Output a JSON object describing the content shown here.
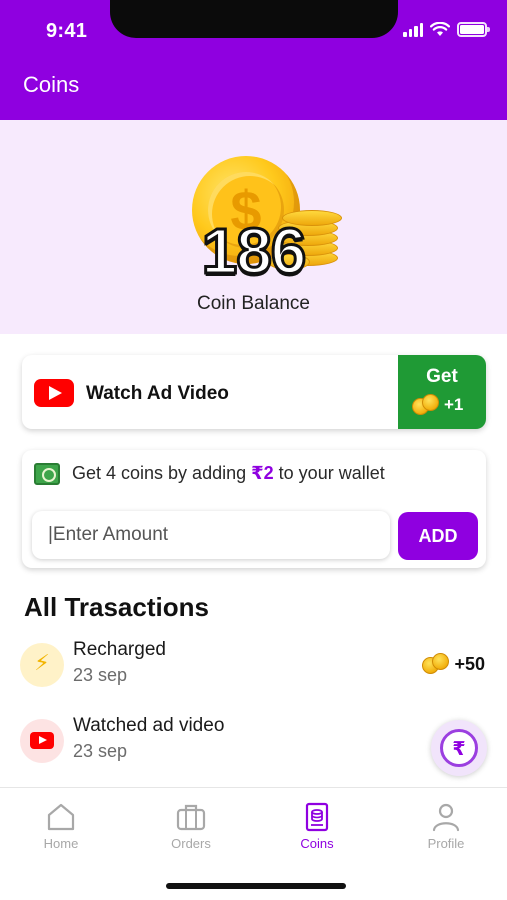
{
  "status_bar": {
    "time": "9:41"
  },
  "header": {
    "title": "Coins"
  },
  "balance": {
    "value": "186",
    "label": "Coin Balance"
  },
  "ad_card": {
    "label": "Watch Ad Video",
    "get_label": "Get",
    "reward": "+1"
  },
  "wallet_offer": {
    "text_before": "Get 4 coins by adding ",
    "amount": "₹2",
    "text_after": " to your wallet",
    "input_placeholder": "|Enter Amount",
    "add_label": "ADD"
  },
  "transactions": {
    "title": "All Trasactions",
    "items": [
      {
        "title": "Recharged",
        "date": "23 sep",
        "amount": "+50",
        "icon": "lightning-icon"
      },
      {
        "title": "Watched ad video",
        "date": "23 sep",
        "amount": "",
        "icon": "youtube-icon"
      }
    ]
  },
  "tab_bar": {
    "items": [
      {
        "label": "Home",
        "icon": "home-icon"
      },
      {
        "label": "Orders",
        "icon": "briefcase-icon"
      },
      {
        "label": "Coins",
        "icon": "coins-book-icon"
      },
      {
        "label": "Profile",
        "icon": "person-icon"
      }
    ],
    "active": "Coins"
  },
  "colors": {
    "brand": "#8f00e0",
    "accent_green": "#1f9a35",
    "panel": "#f7eafd",
    "youtube": "#ff0000"
  }
}
